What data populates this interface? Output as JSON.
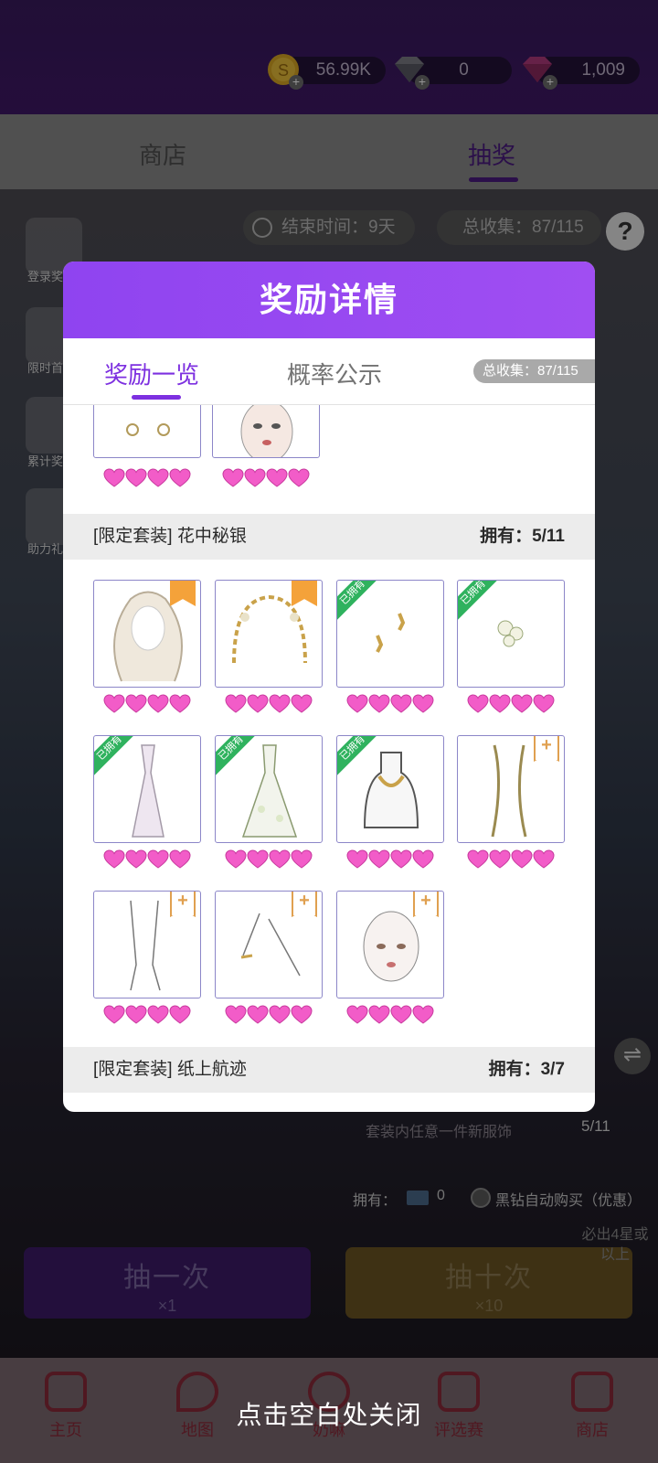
{
  "currency": {
    "coins": "56.99K",
    "diamonds": "0",
    "gems": "1,009"
  },
  "top_tabs": [
    "商店",
    "抽奖"
  ],
  "event": {
    "end_time": "结束时间：9天",
    "total_collect": "总收集：87/115",
    "help": "?"
  },
  "side_menu": [
    "登录奖",
    "限时首",
    "累计奖",
    "助力礼"
  ],
  "draw": {
    "owned_label": "拥有：",
    "owned_count": "0",
    "auto_buy": "黑钻自动购买（优惠）",
    "single_label": "抽一次",
    "single_cost": "×1",
    "ten_label": "抽十次",
    "ten_cost": "×10",
    "guarantee": "必出4星或以上",
    "set_progress": "5/11",
    "set_subtitle": "套装内任意一件新服饰"
  },
  "bottom_nav": [
    "主页",
    "地图",
    "奶嘛",
    "评选赛",
    "商店"
  ],
  "modal": {
    "title": "奖励详情",
    "tabs": [
      "奖励一览",
      "概率公示"
    ],
    "collect_pill": "总收集：87/115",
    "sets": [
      {
        "name": "[限定套装] 花中秘银",
        "owned": "拥有：5/11"
      },
      {
        "name": "[限定套装] 纸上航迹",
        "owned": "拥有：3/7"
      }
    ],
    "owned_ribbon": "已拥有",
    "star_color": "#f25cc8"
  },
  "close_hint": "点击空白处关闭",
  "colors": {
    "accent": "#8f44f0",
    "owned_green": "#2fb25e",
    "bookmark_orange": "#f4a23a"
  }
}
